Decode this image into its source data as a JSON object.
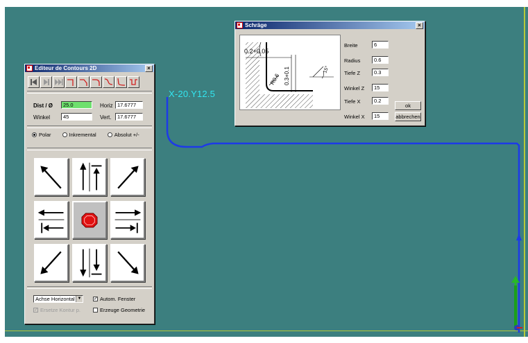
{
  "viewport": {
    "coord_label": "X-20.Y12.5",
    "colors": {
      "background": "#3c7f7f",
      "path": "#1d3ae8",
      "label": "#32e6f0",
      "guide": "#b7c93a"
    }
  },
  "editor": {
    "title": "Editeur de Contours 2D",
    "toolbar_icons": [
      "first-icon",
      "prev-icon",
      "next-icon",
      "corner-down-right-icon",
      "corner-down-left-icon",
      "corner-arc-icon",
      "s-curve-icon",
      "curve-icon",
      "u-curve-icon"
    ],
    "dist_label": "Dist / Ø",
    "dist_value": "25.0",
    "winkel_label": "Winkel",
    "winkel_value": "45",
    "horiz_label": "Horiz",
    "horiz_value": "17.6777",
    "vert_label": "Vert.",
    "vert_value": "17.6777",
    "radio": {
      "polar": "Polar",
      "inkremental": "Inkremental",
      "absolut": "Absolut +/-",
      "selected": "polar"
    },
    "achse_select": "Achse Horizontal",
    "autom_fenster": "Autom. Fenster",
    "autom_fenster_checked": true,
    "ersetze_kontur": "Ersetze Kontur p.",
    "erzeuge_geometrie": "Erzeuge Geometrie"
  },
  "schraege": {
    "title": "Schräge",
    "sketch_dims": {
      "a": "0.2+0.05",
      "b": "R0.6",
      "c": "0.3+0.1",
      "d": "15°"
    },
    "fields": [
      {
        "label": "Breite",
        "value": "6"
      },
      {
        "label": "Radius",
        "value": "0.6"
      },
      {
        "label": "Tiefe Z",
        "value": "0.3"
      },
      {
        "label": "Winkel Z",
        "value": "15"
      },
      {
        "label": "Tiefe X",
        "value": "0.2"
      },
      {
        "label": "Winkel X",
        "value": "15"
      }
    ],
    "ok_label": "ok",
    "cancel_label": "abbrechen"
  }
}
